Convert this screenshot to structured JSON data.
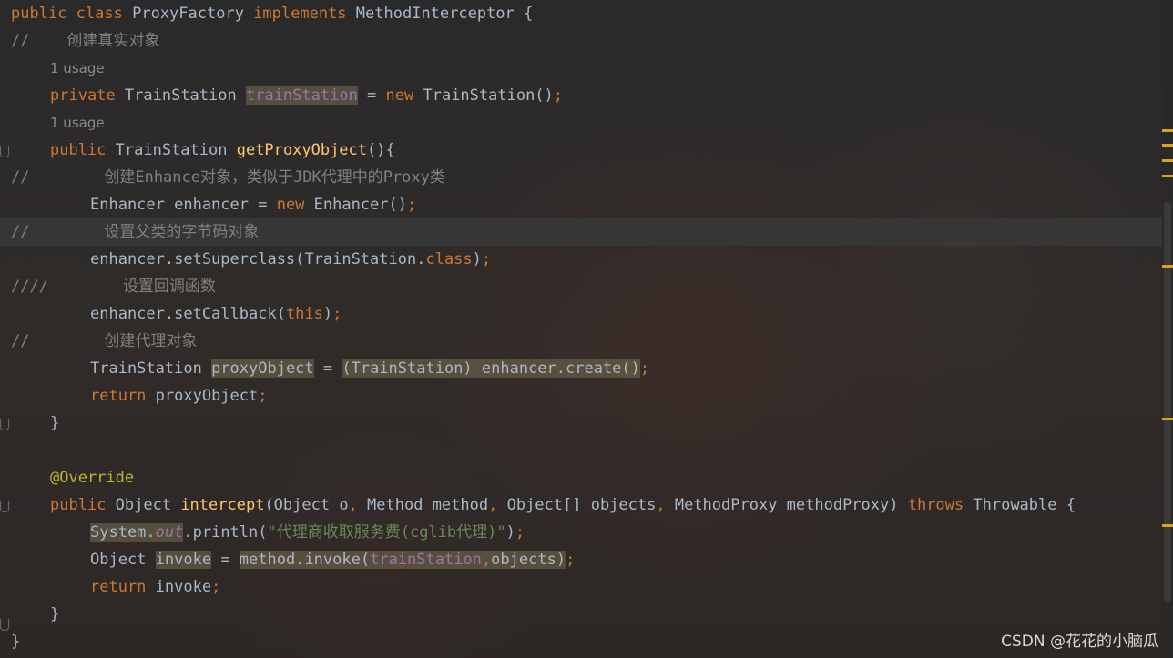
{
  "code": {
    "l1_public": "public",
    "l1_class": "class",
    "l1_name": "ProxyFactory",
    "l1_implements": "implements",
    "l1_iface": "MethodInterceptor",
    "l1_brace": "{",
    "l2_comment": "//    创建真实对象",
    "usage_hint_1": "1 usage",
    "l3_private": "private",
    "l3_type": "TrainStation",
    "l3_field": "trainStation",
    "l3_eq": " = ",
    "l3_new": "new",
    "l3_ctor": " TrainStation()",
    "l3_semi": ";",
    "usage_hint_2": "1 usage",
    "l4_public": "public",
    "l4_type": " TrainStation ",
    "l4_method": "getProxyObject",
    "l4_rest": "(){",
    "l5_comment": "//        创建Enhance对象，类似于JDK代理中的Proxy类",
    "l6_type": "Enhancer enhancer = ",
    "l6_new": "new",
    "l6_rest": " Enhancer()",
    "l6_semi": ";",
    "l7_comment": "//        设置父类的字节码对象",
    "l8_call": "enhancer.setSuperclass(TrainStation.",
    "l8_class": "class",
    "l8_close": ")",
    "l8_semi": ";",
    "l9_comment": "////        设置回调函数",
    "l10_call": "enhancer.setCallback(",
    "l10_this": "this",
    "l10_close": ")",
    "l10_semi": ";",
    "l11_comment": "//        创建代理对象",
    "l12_type": "TrainStation ",
    "l12_var": "proxyObject",
    "l12_eq": " = ",
    "l12_expr": "(TrainStation) enhancer.create()",
    "l12_semi": ";",
    "l13_return": "return",
    "l13_var": " proxyObject",
    "l13_semi": ";",
    "l14_brace": "}",
    "l15_annotation": "@Override",
    "l16_public": "public",
    "l16_type": " Object ",
    "l16_method": "intercept",
    "l16_p1": "(Object o",
    "l16_c1": ",",
    "l16_p2": " Method method",
    "l16_c2": ",",
    "l16_p3": " Object[] objects",
    "l16_c3": ",",
    "l16_p4": " MethodProxy methodProxy) ",
    "l16_throws": "throws",
    "l16_rest": " Throwable {",
    "l17_sys": "System.",
    "l17_out": "out",
    "l17_call": ".println(",
    "l17_str": "\"代理商收取服务费(cglib代理)\"",
    "l17_close": ")",
    "l17_semi": ";",
    "l18_type": "Object ",
    "l18_var": "invoke",
    "l18_eq": " = ",
    "l18_call": "method.invoke(",
    "l18_field": "trainStation",
    "l18_comma": ",",
    "l18_objs": "objects)",
    "l18_semi": ";",
    "l19_return": "return",
    "l19_var": " invoke",
    "l19_semi": ";",
    "l20_brace": "}",
    "l21_brace": "}"
  },
  "watermark": "CSDN @花花的小脑瓜",
  "colors": {
    "background": "#2b2b2b",
    "keyword": "#cc7832",
    "method_decl": "#ffc66d",
    "comment": "#808080",
    "annotation": "#bbb529",
    "string": "#6a8759",
    "field": "#9876aa",
    "text": "#a9b7c6",
    "marker": "#d9a31a"
  }
}
